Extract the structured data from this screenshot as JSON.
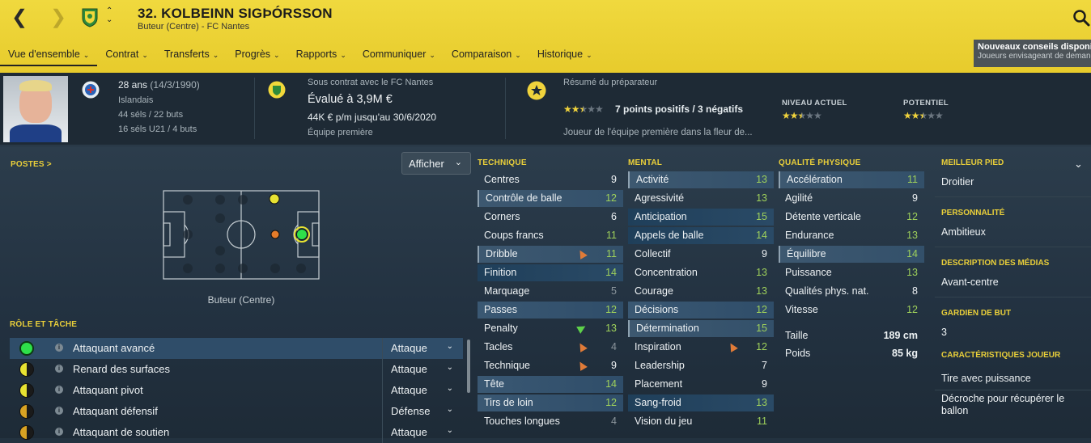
{
  "header": {
    "player_name": "32. KOLBEINN SIGÞÓRSSON",
    "subtitle": "Buteur (Centre) - FC Nantes",
    "back_glyph": "❮",
    "forward_glyph": "❯",
    "up_glyph": "⌃",
    "down_glyph": "⌄",
    "crest_icon": "fc-nantes-crest-icon",
    "search_icon": "search-icon"
  },
  "tabs": [
    {
      "label": "Vue d'ensemble",
      "chevron": "⌄"
    },
    {
      "label": "Contrat",
      "chevron": "⌄"
    },
    {
      "label": "Transferts",
      "chevron": "⌄"
    },
    {
      "label": "Progrès",
      "chevron": "⌄"
    },
    {
      "label": "Rapports",
      "chevron": "⌄"
    },
    {
      "label": "Communiquer",
      "chevron": "⌄"
    },
    {
      "label": "Comparaison",
      "chevron": "⌄"
    },
    {
      "label": "Historique",
      "chevron": "⌄"
    }
  ],
  "notification": {
    "title": "Nouveaux conseils disponibles",
    "text": "Joueurs envisageant de demander"
  },
  "info": {
    "age": "28 ans",
    "dob": "(14/3/1990)",
    "nationality": "Islandais",
    "caps": "44 séls / 22 buts",
    "u21_caps": "16 séls U21 / 4 buts",
    "contract_with": "Sous contrat avec le FC Nantes",
    "value": "Évalué à 3,9M €",
    "wage": "44K € p/m jusqu'au 30/6/2020",
    "squad": "Équipe première",
    "coach_title": "Résumé du préparateur",
    "points_summary": "7 points positifs / 3 négatifs",
    "coach_comment": "Joueur de l'équipe première dans la fleur de...",
    "current_label": "NIVEAU ACTUEL",
    "potential_label": "POTENTIEL",
    "summary_stars": 2.5,
    "current_stars": 2.5,
    "potential_stars": 2.5
  },
  "positions": {
    "section_label": "POSTES >",
    "show_button": "Afficher",
    "show_chevron": "⌄",
    "position_name": "Buteur (Centre)"
  },
  "roles": {
    "section_label": "RÔLE ET TÂCHE",
    "info_glyph": "i",
    "duty_chevron": "⌄",
    "items": [
      {
        "name": "Attaquant avancé",
        "duty": "Attaque",
        "rating": "full"
      },
      {
        "name": "Renard des surfaces",
        "duty": "Attaque",
        "rating": "half"
      },
      {
        "name": "Attaquant pivot",
        "duty": "Attaque",
        "rating": "half"
      },
      {
        "name": "Attaquant défensif",
        "duty": "Défense",
        "rating": "halfo"
      },
      {
        "name": "Attaquant de soutien",
        "duty": "Attaque",
        "rating": "halfo"
      }
    ]
  },
  "technique": {
    "title": "TECHNIQUE",
    "items": [
      {
        "name": "Centres",
        "value": "9",
        "tone": "w",
        "style": "",
        "arrow": ""
      },
      {
        "name": "Contrôle de balle",
        "value": "12",
        "tone": "g",
        "style": "hl2",
        "arrow": ""
      },
      {
        "name": "Corners",
        "value": "6",
        "tone": "w",
        "style": "",
        "arrow": ""
      },
      {
        "name": "Coups francs",
        "value": "11",
        "tone": "g",
        "style": "",
        "arrow": ""
      },
      {
        "name": "Dribble",
        "value": "11",
        "tone": "g",
        "style": "hl2",
        "arrow": "up"
      },
      {
        "name": "Finition",
        "value": "14",
        "tone": "g",
        "style": "dk",
        "arrow": ""
      },
      {
        "name": "Marquage",
        "value": "5",
        "tone": "m",
        "style": "",
        "arrow": ""
      },
      {
        "name": "Passes",
        "value": "12",
        "tone": "g",
        "style": "hl",
        "arrow": ""
      },
      {
        "name": "Penalty",
        "value": "13",
        "tone": "g",
        "style": "",
        "arrow": "green"
      },
      {
        "name": "Tacles",
        "value": "4",
        "tone": "m",
        "style": "",
        "arrow": "up"
      },
      {
        "name": "Technique",
        "value": "9",
        "tone": "w",
        "style": "",
        "arrow": "up"
      },
      {
        "name": "Tête",
        "value": "14",
        "tone": "g",
        "style": "hl",
        "arrow": ""
      },
      {
        "name": "Tirs de loin",
        "value": "12",
        "tone": "g",
        "style": "hl",
        "arrow": ""
      },
      {
        "name": "Touches longues",
        "value": "4",
        "tone": "m",
        "style": "",
        "arrow": ""
      }
    ]
  },
  "mental": {
    "title": "MENTAL",
    "items": [
      {
        "name": "Activité",
        "value": "13",
        "tone": "g",
        "style": "hl2",
        "arrow": ""
      },
      {
        "name": "Agressivité",
        "value": "13",
        "tone": "g",
        "style": "",
        "arrow": ""
      },
      {
        "name": "Anticipation",
        "value": "15",
        "tone": "g",
        "style": "dk",
        "arrow": ""
      },
      {
        "name": "Appels de balle",
        "value": "14",
        "tone": "g",
        "style": "dk",
        "arrow": ""
      },
      {
        "name": "Collectif",
        "value": "9",
        "tone": "w",
        "style": "",
        "arrow": ""
      },
      {
        "name": "Concentration",
        "value": "13",
        "tone": "g",
        "style": "",
        "arrow": ""
      },
      {
        "name": "Courage",
        "value": "13",
        "tone": "g",
        "style": "",
        "arrow": ""
      },
      {
        "name": "Décisions",
        "value": "12",
        "tone": "g",
        "style": "hl",
        "arrow": ""
      },
      {
        "name": "Détermination",
        "value": "15",
        "tone": "g",
        "style": "hl2",
        "arrow": ""
      },
      {
        "name": "Inspiration",
        "value": "12",
        "tone": "g",
        "style": "",
        "arrow": "up"
      },
      {
        "name": "Leadership",
        "value": "7",
        "tone": "w",
        "style": "",
        "arrow": ""
      },
      {
        "name": "Placement",
        "value": "9",
        "tone": "w",
        "style": "",
        "arrow": ""
      },
      {
        "name": "Sang-froid",
        "value": "13",
        "tone": "g",
        "style": "dk",
        "arrow": ""
      },
      {
        "name": "Vision du jeu",
        "value": "11",
        "tone": "g",
        "style": "",
        "arrow": ""
      }
    ]
  },
  "physical": {
    "title": "QUALITÉ PHYSIQUE",
    "items": [
      {
        "name": "Accélération",
        "value": "11",
        "tone": "g",
        "style": "hl2",
        "arrow": ""
      },
      {
        "name": "Agilité",
        "value": "9",
        "tone": "w",
        "style": "",
        "arrow": ""
      },
      {
        "name": "Détente verticale",
        "value": "12",
        "tone": "g",
        "style": "",
        "arrow": ""
      },
      {
        "name": "Endurance",
        "value": "13",
        "tone": "g",
        "style": "",
        "arrow": ""
      },
      {
        "name": "Équilibre",
        "value": "14",
        "tone": "g",
        "style": "hl2",
        "arrow": ""
      },
      {
        "name": "Puissance",
        "value": "13",
        "tone": "g",
        "style": "",
        "arrow": ""
      },
      {
        "name": "Qualités phys. nat.",
        "value": "8",
        "tone": "w",
        "style": "",
        "arrow": ""
      },
      {
        "name": "Vitesse",
        "value": "12",
        "tone": "g",
        "style": "",
        "arrow": ""
      }
    ],
    "height_label": "Taille",
    "height_value": "189 cm",
    "weight_label": "Poids",
    "weight_value": "85 kg"
  },
  "right_panel": {
    "chevron": "⌄",
    "best_foot_label": "MEILLEUR PIED",
    "best_foot": "Droitier",
    "personality_label": "PERSONNALITÉ",
    "personality": "Ambitieux",
    "media_label": "DESCRIPTION DES MÉDIAS",
    "media": "Avant-centre",
    "goalkeeper_label": "GARDIEN DE BUT",
    "goalkeeper": "3",
    "traits_label": "CARACTÉRISTIQUES JOUEUR",
    "trait1": "Tire avec puissance",
    "trait2": "Décroche pour récupérer le ballon"
  },
  "colors": {
    "header_yellow": "#f0d93e",
    "accent_yellow": "#e9cf3a",
    "green_value": "#9fd15b",
    "selected_row": "#2f4d69"
  }
}
